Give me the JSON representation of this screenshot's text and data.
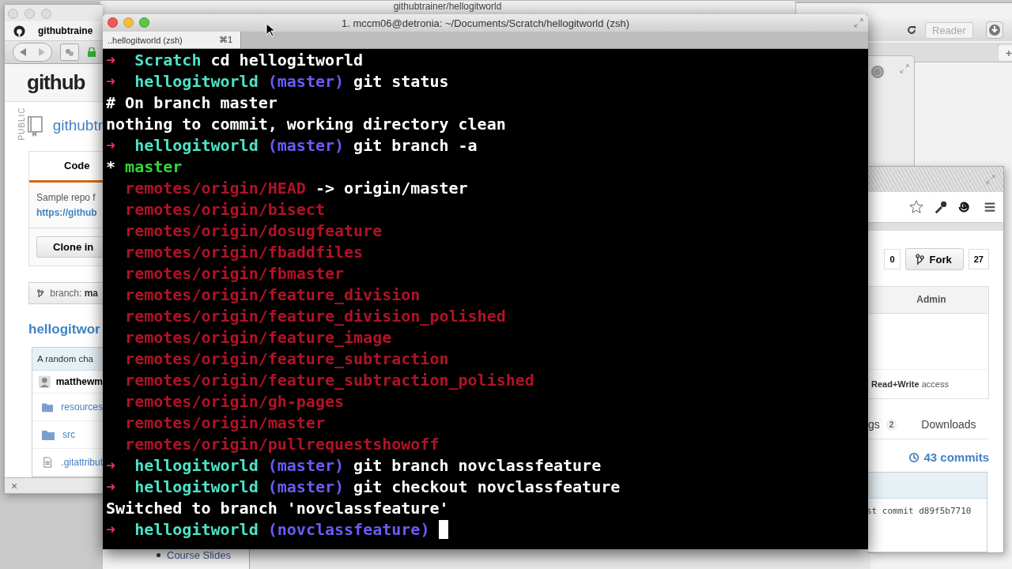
{
  "background_window": {
    "title": "githubtrainer/hellogitworld"
  },
  "top_browser": {
    "reader_button": "Reader"
  },
  "left_browser": {
    "tab_title": "githubtraine",
    "logo": "github",
    "visibility": "PUBLIC",
    "repo_name": "githubtr",
    "tabs": [
      {
        "label": "Code",
        "selected": true
      }
    ],
    "description": "Sample repo f",
    "clone_url": "https://github",
    "clone_button": "Clone in",
    "branch_button": "branch: **ma**",
    "folder_title": "hellogitwor",
    "commit_message": "A random cha",
    "author": "matthewm",
    "files": [
      {
        "kind": "folder",
        "name": "resources"
      },
      {
        "kind": "folder",
        "name": "src"
      },
      {
        "kind": "file",
        "name": ".gitattribut"
      }
    ],
    "close_label": "×"
  },
  "terminal": {
    "title": "1. mccm06@detronia: ~/Documents/Scratch/hellogitworld (zsh)",
    "tab": {
      "label": "..hellogitworld (zsh)",
      "shortcut": "⌘1",
      "selected": true
    },
    "lines": [
      {
        "kind": "prompt",
        "arrow": "➜",
        "dir": "Scratch",
        "command": "cd hellogitworld"
      },
      {
        "kind": "prompt",
        "arrow": "➜",
        "dir": "hellogitworld",
        "branch": "(master)",
        "command": "git status"
      },
      {
        "kind": "output",
        "text": "# On branch master"
      },
      {
        "kind": "output",
        "text": "nothing to commit, working directory clean"
      },
      {
        "kind": "prompt",
        "arrow": "➜",
        "dir": "hellogitworld",
        "branch": "(master)",
        "command": "git branch -a"
      },
      {
        "kind": "current",
        "marker": "*",
        "name": "master"
      },
      {
        "kind": "remote",
        "name": "remotes/origin/HEAD",
        "target": "-> origin/master"
      },
      {
        "kind": "remote",
        "name": "remotes/origin/bisect"
      },
      {
        "kind": "remote",
        "name": "remotes/origin/dosugfeature"
      },
      {
        "kind": "remote",
        "name": "remotes/origin/fbaddfiles"
      },
      {
        "kind": "remote",
        "name": "remotes/origin/fbmaster"
      },
      {
        "kind": "remote",
        "name": "remotes/origin/feature_division"
      },
      {
        "kind": "remote",
        "name": "remotes/origin/feature_division_polished"
      },
      {
        "kind": "remote",
        "name": "remotes/origin/feature_image"
      },
      {
        "kind": "remote",
        "name": "remotes/origin/feature_subtraction"
      },
      {
        "kind": "remote",
        "name": "remotes/origin/feature_subtraction_polished"
      },
      {
        "kind": "remote",
        "name": "remotes/origin/gh-pages"
      },
      {
        "kind": "remote",
        "name": "remotes/origin/master"
      },
      {
        "kind": "remote",
        "name": "remotes/origin/pullrequestshowoff"
      },
      {
        "kind": "prompt",
        "arrow": "➜",
        "dir": "hellogitworld",
        "branch": "(master)",
        "command": "git branch novclassfeature"
      },
      {
        "kind": "prompt",
        "arrow": "➜",
        "dir": "hellogitworld",
        "branch": "(master)",
        "command": "git checkout novclassfeature"
      },
      {
        "kind": "output",
        "text": "Switched to branch 'novclassfeature'"
      },
      {
        "kind": "prompt",
        "arrow": "➜",
        "dir": "hellogitworld",
        "branch": "(novclassfeature)",
        "cursor": true
      }
    ]
  },
  "right_browser": {
    "star_count": "0",
    "fork_button": "Fork",
    "fork_count": "27",
    "tabs": [
      {
        "label": "Admin",
        "selected": false
      }
    ],
    "access_text": "**Read+Write** access",
    "nav": [
      {
        "label": "gs",
        "count": "2"
      },
      {
        "label": "Downloads"
      }
    ],
    "commits_link": "43 commits",
    "last_commit": "st commit d89f5b7710"
  },
  "bottom_page": {
    "list_items": [
      "Course Slides"
    ]
  }
}
